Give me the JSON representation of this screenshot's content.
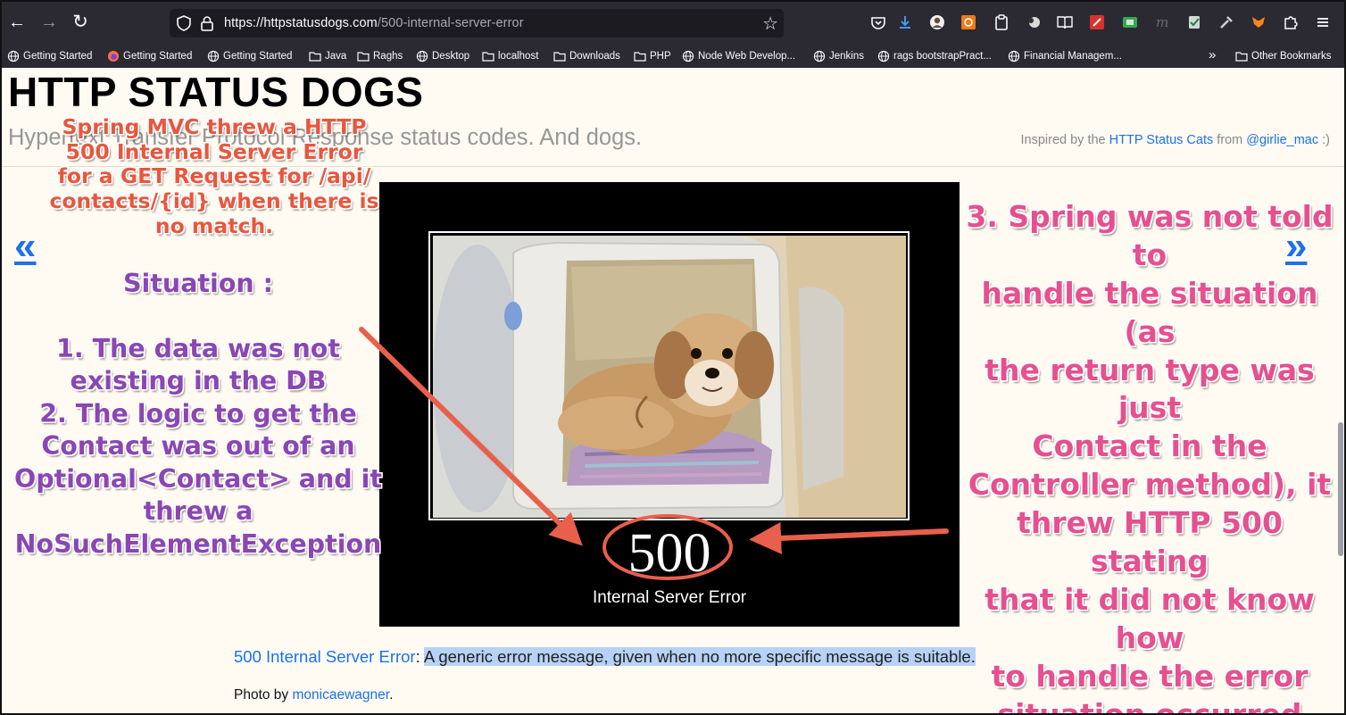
{
  "browser": {
    "url_host": "https://httpstatusdogs.com",
    "url_path": "/500-internal-server-error",
    "bookmarks": [
      {
        "label": "Getting Started",
        "icon": "globe-icon"
      },
      {
        "label": "Getting Started",
        "icon": "firefox-icon"
      },
      {
        "label": "Getting Started",
        "icon": "globe-icon"
      },
      {
        "label": "Java",
        "icon": "folder-icon"
      },
      {
        "label": "Raghs",
        "icon": "folder-icon"
      },
      {
        "label": "Desktop",
        "icon": "globe-icon"
      },
      {
        "label": "localhost",
        "icon": "folder-icon"
      },
      {
        "label": "Downloads",
        "icon": "folder-icon"
      },
      {
        "label": "PHP",
        "icon": "folder-icon"
      },
      {
        "label": "Node Web Develop...",
        "icon": "globe-icon"
      },
      {
        "label": "Jenkins",
        "icon": "globe-icon"
      },
      {
        "label": "rags bootstrapPract...",
        "icon": "globe-icon"
      },
      {
        "label": "Financial Managem...",
        "icon": "globe-icon"
      }
    ],
    "other_bookmarks": "Other Bookmarks",
    "overflow": "»"
  },
  "page": {
    "title": "HTTP STATUS DOGS",
    "subtitle": "Hypertext Transfer Protocol Response status codes. And dogs.",
    "inspired_prefix": "Inspired by the",
    "inspired_link": "HTTP Status Cats",
    "inspired_mid": "from",
    "inspired_author": "@girlie_mac",
    "inspired_suffix": ":)",
    "prev": "«",
    "next": "»",
    "photo_code": "500",
    "photo_caption": "Internal Server Error",
    "status_link": "500 Internal Server Error",
    "status_sep": ":",
    "status_desc": "A generic error message, given when no more specific message is suitable.",
    "photo_by_prefix": "Photo by",
    "photo_by_author": "monicaewagner",
    "photo_by_suffix": "."
  },
  "annotations": {
    "red_lines": [
      "Spring MVC threw a HTTP",
      "500 Internal Server Error",
      "for a GET Request for /api/",
      "contacts/{id} when there is",
      "no match."
    ],
    "purple_lines": [
      "Situation :",
      "",
      "1. The data was not",
      "existing in the DB",
      "2. The logic to get the",
      "Contact was out of an",
      "Optional<Contact> and it",
      "threw a",
      "NoSuchElementException"
    ],
    "pink_lines": [
      "3. Spring was not told to",
      "handle the situation (as",
      "the return type was just",
      "Contact in the",
      "Controller method), it",
      "threw HTTP 500 stating",
      "that it did not know how",
      "to handle the error",
      "situation occurred"
    ],
    "colors": {
      "red": "#e8573d",
      "purple": "#8a47b3",
      "pink": "#e6508e",
      "arrow": "#e8604c"
    }
  }
}
